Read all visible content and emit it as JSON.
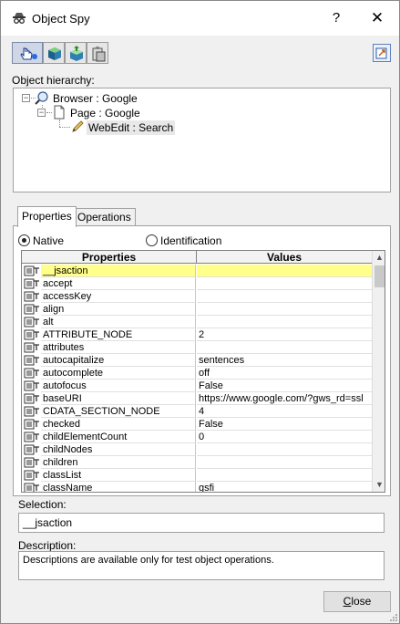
{
  "window": {
    "title": "Object Spy",
    "help_glyph": "?",
    "close_glyph": "✕"
  },
  "toolbar": {
    "buttons": [
      "pointing-hand-icon",
      "highlight-object-icon",
      "record-object-icon",
      "copy-clipboard-icon"
    ],
    "pin": "keep-on-top-icon"
  },
  "hierarchy": {
    "label": "Object hierarchy:",
    "items": [
      {
        "text": "Browser : Google",
        "icon": "browser-icon"
      },
      {
        "text": "Page : Google",
        "icon": "page-icon"
      },
      {
        "text": "WebEdit : Search",
        "icon": "webedit-pencil-icon"
      }
    ]
  },
  "tabs": [
    {
      "label": "Properties",
      "active": true
    },
    {
      "label": "Operations",
      "active": false
    }
  ],
  "mode": {
    "native_label": "Native",
    "identification_label": "Identification",
    "selected": "Native"
  },
  "grid": {
    "headers": {
      "properties": "Properties",
      "values": "Values"
    },
    "rows": [
      {
        "name": "__jsaction",
        "value": "",
        "selected": true
      },
      {
        "name": "accept",
        "value": ""
      },
      {
        "name": "accessKey",
        "value": ""
      },
      {
        "name": "align",
        "value": ""
      },
      {
        "name": "alt",
        "value": ""
      },
      {
        "name": "ATTRIBUTE_NODE",
        "value": "2"
      },
      {
        "name": "attributes",
        "value": ""
      },
      {
        "name": "autocapitalize",
        "value": "sentences"
      },
      {
        "name": "autocomplete",
        "value": "off"
      },
      {
        "name": "autofocus",
        "value": "False"
      },
      {
        "name": "baseURI",
        "value": "https://www.google.com/?gws_rd=ssl"
      },
      {
        "name": "CDATA_SECTION_NODE",
        "value": "4"
      },
      {
        "name": "checked",
        "value": "False"
      },
      {
        "name": "childElementCount",
        "value": "0"
      },
      {
        "name": "childNodes",
        "value": ""
      },
      {
        "name": "children",
        "value": ""
      },
      {
        "name": "classList",
        "value": ""
      },
      {
        "name": "className",
        "value": "gsfi"
      }
    ]
  },
  "selection": {
    "label": "Selection:",
    "value": "__jsaction"
  },
  "description": {
    "label": "Description:",
    "value": "Descriptions are available only for test object operations."
  },
  "buttons": {
    "close_underlined": "C",
    "close_rest": "lose"
  },
  "colors": {
    "selected_row": "#ffff8a",
    "window_bg": "#f0f0f0"
  }
}
